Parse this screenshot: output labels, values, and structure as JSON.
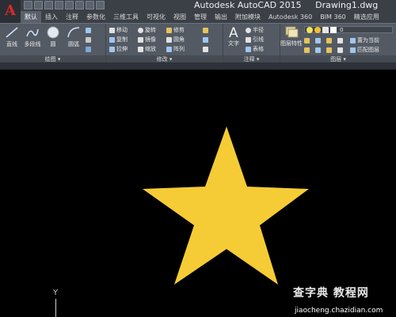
{
  "window": {
    "app_title": "Autodesk AutoCAD 2015",
    "document_title": "Drawing1.dwg",
    "app_button_glyph": "A"
  },
  "tabs": [
    "默认",
    "插入",
    "注释",
    "参数化",
    "三维工具",
    "可视化",
    "视图",
    "管理",
    "输出",
    "附加模块",
    "Autodesk 360",
    "BIM 360",
    "精选应用"
  ],
  "ribbon": {
    "draw_panel": {
      "label": "绘图 ▾",
      "tools": [
        "直线",
        "多段线",
        "圆",
        "圆弧"
      ]
    },
    "modify_panel": {
      "label": "修改 ▾",
      "tools": [
        "移动",
        "旋转",
        "修剪",
        "复制",
        "镜像",
        "圆角",
        "拉伸",
        "缩放",
        "阵列"
      ]
    },
    "annotation_panel": {
      "label": "注释 ▾",
      "tools": [
        "文字",
        "半径",
        "引线",
        "表格"
      ]
    },
    "layers_panel": {
      "label": "图层 ▾",
      "tools": [
        "图层特性",
        "置为当前",
        "匹配图层"
      ],
      "layer_value": "0"
    }
  },
  "canvas": {
    "star_color": "#f5cc35",
    "background": "#000000",
    "ucs_axis_label": "Y"
  },
  "watermark": {
    "main": "查字典 教程网",
    "url": "jiaocheng.chazidian.com"
  }
}
